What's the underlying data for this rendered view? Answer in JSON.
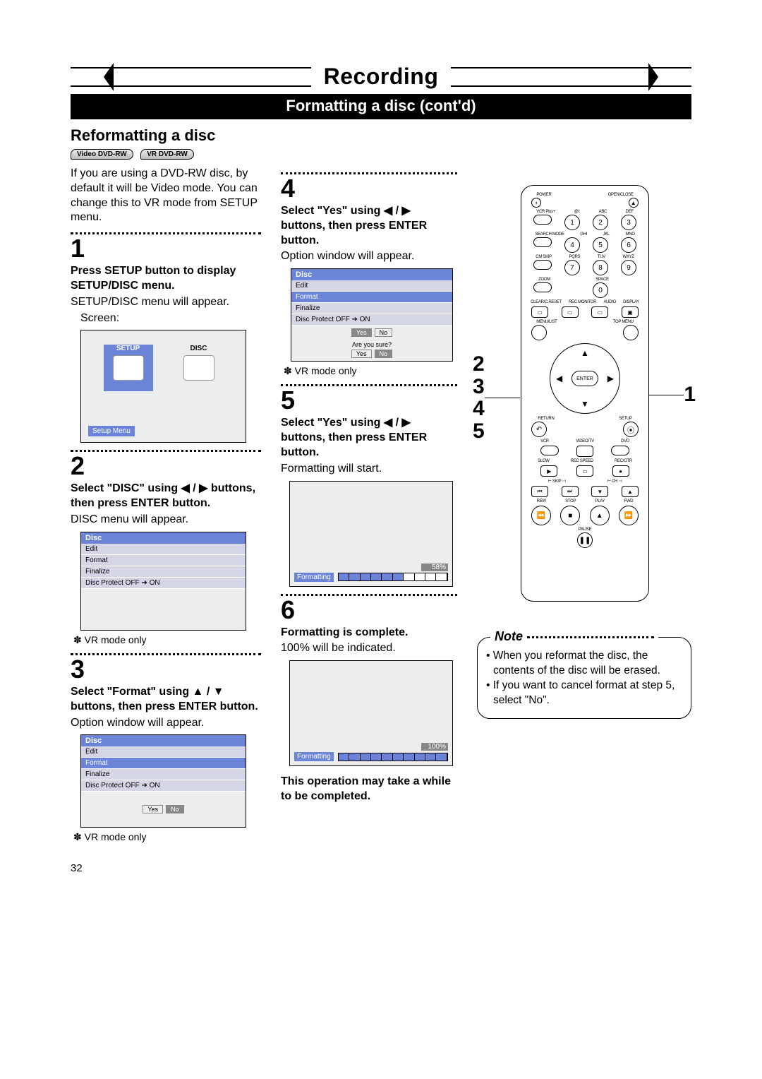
{
  "header": {
    "title": "Recording",
    "subtitle": "Formatting a disc (cont'd)",
    "section": "Reformatting a disc",
    "badges": [
      "Video DVD-RW",
      "VR DVD-RW"
    ]
  },
  "intro": "If you are using a DVD-RW disc, by default it will be Video mode. You can change this to VR mode from SETUP menu.",
  "steps": {
    "s1": {
      "num": "1",
      "title": "Press SETUP button to display SETUP/DISC menu.",
      "sub": "SETUP/DISC menu will appear.",
      "screen_lbl": "Screen:",
      "setup": {
        "tab1": "SETUP",
        "tab2": "DISC",
        "foot": "Setup Menu"
      }
    },
    "s2": {
      "num": "2",
      "title": "Select \"DISC\" using ◀ / ▶ buttons, then press ENTER button.",
      "sub": "DISC menu will appear.",
      "menu": {
        "head": "Disc",
        "items": [
          "Edit",
          "Format",
          "Finalize",
          "Disc Protect OFF ➔ ON"
        ]
      },
      "note": "✽ VR mode only"
    },
    "s3": {
      "num": "3",
      "title": "Select \"Format\" using ▲ / ▼ buttons, then press ENTER button.",
      "sub": "Option window will appear.",
      "menu": {
        "head": "Disc",
        "items": [
          "Edit",
          "Format",
          "Finalize",
          "Disc Protect OFF ➔ ON"
        ],
        "opt_yes": "Yes",
        "opt_no": "No"
      },
      "note": "✽ VR mode only"
    },
    "s4": {
      "num": "4",
      "title": "Select \"Yes\" using ◀ / ▶ buttons, then press ENTER button.",
      "sub": "Option window will appear.",
      "menu": {
        "head": "Disc",
        "items": [
          "Edit",
          "Format",
          "Finalize",
          "Disc Protect OFF ➔ ON"
        ],
        "opt_yes": "Yes",
        "opt_no": "No",
        "confirm": "Are you sure?",
        "c_yes": "Yes",
        "c_no": "No"
      },
      "note": "✽ VR mode only"
    },
    "s5": {
      "num": "5",
      "title": "Select \"Yes\" using ◀ / ▶ buttons, then press ENTER button.",
      "sub": "Formatting will start.",
      "prog": {
        "label": "Formatting",
        "pct": "58%",
        "fill": 6
      }
    },
    "s6": {
      "num": "6",
      "title": "Formatting is complete.",
      "sub": "100% will be indicated.",
      "prog": {
        "label": "Formatting",
        "pct": "100%",
        "fill": 10
      }
    }
  },
  "warning": "This operation may take a while to be completed.",
  "remote": {
    "labelsTop": [
      "POWER",
      "OPEN/CLOSE"
    ],
    "nums": [
      "1",
      "2",
      "3",
      "4",
      "5",
      "6",
      "7",
      "8",
      "9",
      "0"
    ],
    "numLblTop": [
      "VCR Plus+",
      "@/:",
      "ABC",
      "DEF"
    ],
    "numLblMid": [
      "SEARCH MODE",
      "GHI",
      "JKL",
      "MNO"
    ],
    "numLblBot": [
      "CM SKIP",
      "PQRS",
      "TUV",
      "WXYZ"
    ],
    "zoom": "ZOOM",
    "space": "SPACE",
    "rowA": [
      "CLEAR/C.RESET",
      "REC MONITOR",
      "AUDIO",
      "DISPLAY"
    ],
    "rowB": [
      "MENU/LIST",
      "",
      "",
      "TOP MENU"
    ],
    "enter": "ENTER",
    "rowC": [
      "RETURN",
      "SETUP"
    ],
    "rowD": [
      "VCR",
      "VIDEO/TV",
      "DVD"
    ],
    "rowE": [
      "SLOW",
      "REC SPEED",
      "REC/OTR"
    ],
    "rowF_lbl": [
      "SKIP",
      "CH"
    ],
    "rowG": [
      "REW",
      "STOP",
      "PLAY",
      "FWD"
    ],
    "pause": "PAUSE",
    "callouts": {
      "left": [
        "2",
        "3",
        "4",
        "5"
      ],
      "right": "1"
    }
  },
  "note": {
    "head": "Note",
    "items": [
      "When you reformat the disc, the contents of the disc will be erased.",
      "If you want to cancel format at step 5, select \"No\"."
    ]
  },
  "pagenum": "32"
}
